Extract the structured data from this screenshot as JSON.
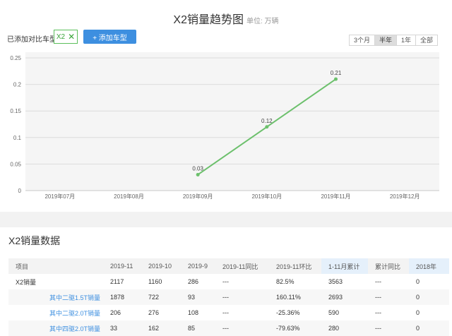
{
  "chart_panel": {
    "title": "X2销量趋势图",
    "unit": "单位: 万辆",
    "added_label": "已添加对比车型:",
    "car_tag": {
      "label": "X2",
      "remove_icon": "close-icon"
    },
    "add_button": "+ 添加车型",
    "ranges": [
      "3个月",
      "半年",
      "1年",
      "全部"
    ],
    "active_range": "半年"
  },
  "chart_data": {
    "type": "line",
    "categories": [
      "2019年07月",
      "2019年08月",
      "2019年09月",
      "2019年10月",
      "2019年11月",
      "2019年12月"
    ],
    "series": [
      {
        "values": [
          null,
          null,
          0.03,
          0.12,
          0.21,
          null
        ],
        "color": "#6cc06c"
      }
    ],
    "data_labels": [
      "",
      "",
      "0.03",
      "0.12",
      "0.21",
      ""
    ],
    "ylim": [
      0,
      0.25
    ],
    "yticks": [
      0,
      0.05,
      0.1,
      0.15,
      0.2,
      0.25
    ],
    "ytick_labels": [
      "0",
      "0.05",
      "0.1",
      "0.15",
      "0.2",
      "0.25"
    ],
    "grid": true
  },
  "data_panel": {
    "title": "X2销量数据",
    "headers": [
      "项目",
      "2019-11",
      "2019-10",
      "2019-9",
      "2019-11同比",
      "2019-11环比",
      "1-11月累计",
      "累计同比",
      "2018年"
    ],
    "rows": [
      {
        "cells": [
          "X2销量",
          "2117",
          "1160",
          "286",
          "---",
          "82.5%",
          "3563",
          "---",
          "0"
        ]
      },
      {
        "cells": [
          "其中二驱1.5T销量",
          "1878",
          "722",
          "93",
          "---",
          "160.11%",
          "2693",
          "---",
          "0"
        ]
      },
      {
        "cells": [
          "其中二驱2.0T销量",
          "206",
          "276",
          "108",
          "---",
          "-25.36%",
          "590",
          "---",
          "0"
        ]
      },
      {
        "cells": [
          "其中四驱2.0T销量",
          "33",
          "162",
          "85",
          "---",
          "-79.63%",
          "280",
          "---",
          "0"
        ]
      }
    ]
  }
}
